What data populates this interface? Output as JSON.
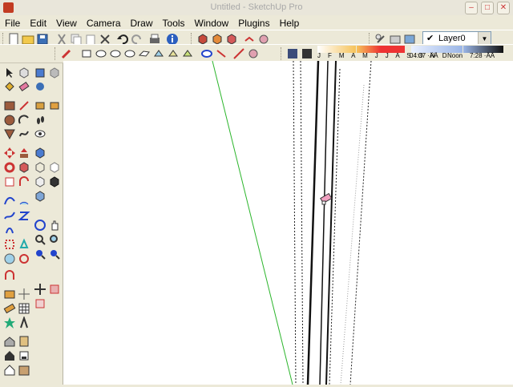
{
  "window": {
    "title": "Untitled - SketchUp Pro"
  },
  "menu": {
    "items": [
      "File",
      "Edit",
      "View",
      "Camera",
      "Draw",
      "Tools",
      "Window",
      "Plugins",
      "Help"
    ]
  },
  "layer": {
    "current": "Layer0"
  },
  "shadow": {
    "months": "J F M A M J J A S O N D",
    "time_start": "04:37 ·ÄÄ",
    "time_mid": "Noon",
    "time_end": "7:28 ·ÄÄ"
  },
  "colors": {
    "toolbar_bg": "#ece9d8",
    "viewport_bg": "#ffffff",
    "green_axis": "#2bb52b",
    "highlight": "#f0a0c0"
  }
}
